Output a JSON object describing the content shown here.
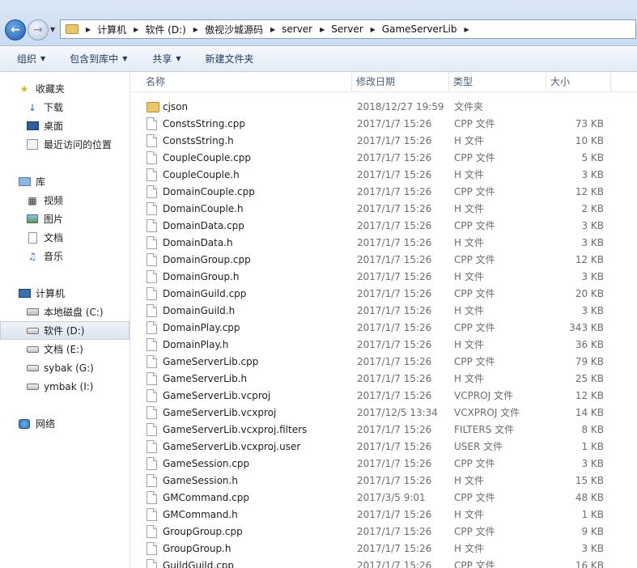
{
  "address": {
    "breadcrumbs": [
      "计算机",
      "软件 (D:)",
      "傲视沙城源码",
      "server",
      "Server",
      "GameServerLib"
    ]
  },
  "toolbar": {
    "organize_label": "组织",
    "include_label": "包含到库中",
    "share_label": "共享",
    "new_folder_label": "新建文件夹"
  },
  "navigation": {
    "favorites": {
      "label": "收藏夹",
      "items": [
        "下载",
        "桌面",
        "最近访问的位置"
      ]
    },
    "libraries": {
      "label": "库",
      "items": [
        "视频",
        "图片",
        "文档",
        "音乐"
      ]
    },
    "computer": {
      "label": "计算机",
      "items": [
        "本地磁盘 (C:)",
        "软件 (D:)",
        "文档 (E:)",
        "sybak (G:)",
        "ymbak (I:)"
      ],
      "selected_item": "软件 (D:)"
    },
    "network": {
      "label": "网络"
    }
  },
  "columns": {
    "name": "名称",
    "date": "修改日期",
    "type": "类型",
    "size": "大小"
  },
  "files": [
    {
      "name": "cjson",
      "date": "2018/12/27 19:59",
      "type": "文件夹",
      "size": "",
      "icon": "folder"
    },
    {
      "name": "ConstsString.cpp",
      "date": "2017/1/7 15:26",
      "type": "CPP 文件",
      "size": "73 KB",
      "icon": "file"
    },
    {
      "name": "ConstsString.h",
      "date": "2017/1/7 15:26",
      "type": "H 文件",
      "size": "10 KB",
      "icon": "file"
    },
    {
      "name": "CoupleCouple.cpp",
      "date": "2017/1/7 15:26",
      "type": "CPP 文件",
      "size": "5 KB",
      "icon": "file"
    },
    {
      "name": "CoupleCouple.h",
      "date": "2017/1/7 15:26",
      "type": "H 文件",
      "size": "3 KB",
      "icon": "file"
    },
    {
      "name": "DomainCouple.cpp",
      "date": "2017/1/7 15:26",
      "type": "CPP 文件",
      "size": "12 KB",
      "icon": "file"
    },
    {
      "name": "DomainCouple.h",
      "date": "2017/1/7 15:26",
      "type": "H 文件",
      "size": "2 KB",
      "icon": "file"
    },
    {
      "name": "DomainData.cpp",
      "date": "2017/1/7 15:26",
      "type": "CPP 文件",
      "size": "3 KB",
      "icon": "file"
    },
    {
      "name": "DomainData.h",
      "date": "2017/1/7 15:26",
      "type": "H 文件",
      "size": "3 KB",
      "icon": "file"
    },
    {
      "name": "DomainGroup.cpp",
      "date": "2017/1/7 15:26",
      "type": "CPP 文件",
      "size": "12 KB",
      "icon": "file"
    },
    {
      "name": "DomainGroup.h",
      "date": "2017/1/7 15:26",
      "type": "H 文件",
      "size": "3 KB",
      "icon": "file"
    },
    {
      "name": "DomainGuild.cpp",
      "date": "2017/1/7 15:26",
      "type": "CPP 文件",
      "size": "20 KB",
      "icon": "file"
    },
    {
      "name": "DomainGuild.h",
      "date": "2017/1/7 15:26",
      "type": "H 文件",
      "size": "3 KB",
      "icon": "file"
    },
    {
      "name": "DomainPlay.cpp",
      "date": "2017/1/7 15:26",
      "type": "CPP 文件",
      "size": "343 KB",
      "icon": "file"
    },
    {
      "name": "DomainPlay.h",
      "date": "2017/1/7 15:26",
      "type": "H 文件",
      "size": "36 KB",
      "icon": "file"
    },
    {
      "name": "GameServerLib.cpp",
      "date": "2017/1/7 15:26",
      "type": "CPP 文件",
      "size": "79 KB",
      "icon": "file"
    },
    {
      "name": "GameServerLib.h",
      "date": "2017/1/7 15:26",
      "type": "H 文件",
      "size": "25 KB",
      "icon": "file"
    },
    {
      "name": "GameServerLib.vcproj",
      "date": "2017/1/7 15:26",
      "type": "VCPROJ 文件",
      "size": "12 KB",
      "icon": "file"
    },
    {
      "name": "GameServerLib.vcxproj",
      "date": "2017/12/5 13:34",
      "type": "VCXPROJ 文件",
      "size": "14 KB",
      "icon": "file"
    },
    {
      "name": "GameServerLib.vcxproj.filters",
      "date": "2017/1/7 15:26",
      "type": "FILTERS 文件",
      "size": "8 KB",
      "icon": "file"
    },
    {
      "name": "GameServerLib.vcxproj.user",
      "date": "2017/1/7 15:26",
      "type": "USER 文件",
      "size": "1 KB",
      "icon": "file"
    },
    {
      "name": "GameSession.cpp",
      "date": "2017/1/7 15:26",
      "type": "CPP 文件",
      "size": "3 KB",
      "icon": "file"
    },
    {
      "name": "GameSession.h",
      "date": "2017/1/7 15:26",
      "type": "H 文件",
      "size": "15 KB",
      "icon": "file"
    },
    {
      "name": "GMCommand.cpp",
      "date": "2017/3/5 9:01",
      "type": "CPP 文件",
      "size": "48 KB",
      "icon": "file"
    },
    {
      "name": "GMCommand.h",
      "date": "2017/1/7 15:26",
      "type": "H 文件",
      "size": "1 KB",
      "icon": "file"
    },
    {
      "name": "GroupGroup.cpp",
      "date": "2017/1/7 15:26",
      "type": "CPP 文件",
      "size": "9 KB",
      "icon": "file"
    },
    {
      "name": "GroupGroup.h",
      "date": "2017/1/7 15:26",
      "type": "H 文件",
      "size": "3 KB",
      "icon": "file"
    },
    {
      "name": "GuildGuild.cpp",
      "date": "2017/1/7 15:26",
      "type": "CPP 文件",
      "size": "16 KB",
      "icon": "file"
    }
  ]
}
